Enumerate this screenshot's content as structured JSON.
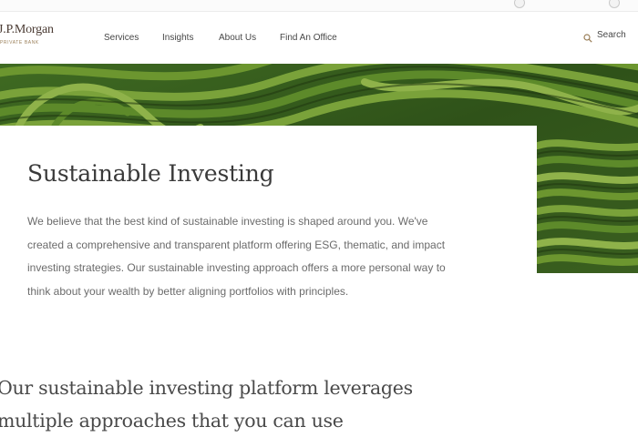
{
  "brand": {
    "wordmark": "J.P.Morgan",
    "subline": "Private Bank",
    "accent_color": "#9a7f58"
  },
  "nav": {
    "items": [
      {
        "label": "Services"
      },
      {
        "label": "Insights"
      },
      {
        "label": "About Us"
      },
      {
        "label": "Find An Office"
      }
    ],
    "search_label": "Search",
    "search_icon": "search-icon"
  },
  "hero": {
    "title": "Sustainable Investing",
    "body_lines": [
      "We believe that the best kind of sustainable investing is shaped around you. We've",
      "created a comprehensive and transparent platform offering ESG, thematic, and impact",
      "investing strategies. Our sustainable investing approach offers a more personal way to",
      "think about your wealth by better aligning portfolios with principles."
    ],
    "image_subject": "terraced green tea field",
    "image_colors": [
      "#2e4a1a",
      "#4f7a26",
      "#7aa23a"
    ]
  },
  "section": {
    "heading_lines": [
      "Our sustainable investing platform leverages",
      "multiple approaches that you can use"
    ]
  }
}
